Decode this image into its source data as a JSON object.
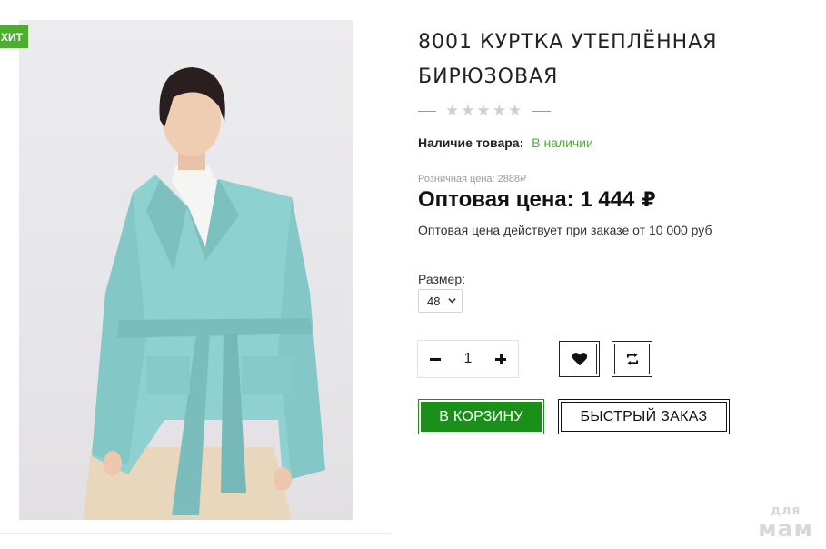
{
  "badge": {
    "label": "ХИТ"
  },
  "product": {
    "title": "8001 КУРТКА УТЕПЛЁННАЯ БИРЮЗОВАЯ",
    "rating": {
      "value": 0,
      "max": 5
    },
    "stock": {
      "label": "Наличие товара:",
      "value": "В наличии"
    },
    "retail_price": "Розничная цена: 2888₽",
    "wholesale": {
      "label": "Оптовая цена: 1 444",
      "currency": "₽"
    },
    "wholesale_note": "Оптовая цена действует при заказе от 10 000 руб",
    "size": {
      "label": "Размер:",
      "selected": "48"
    },
    "quantity": "1"
  },
  "actions": {
    "add_to_cart": "В КОРЗИНУ",
    "quick_order": "БЫСТРЫЙ ЗАКАЗ",
    "wishlist_icon": "heart-icon",
    "compare_icon": "compare-arrows-icon"
  },
  "watermark": {
    "line1": "для",
    "line2": "мам"
  },
  "colors": {
    "accent_green": "#1a8f1a",
    "stock_green": "#4cae2e",
    "badge_green": "#4cae2e",
    "coat": "#8fd1d0"
  }
}
